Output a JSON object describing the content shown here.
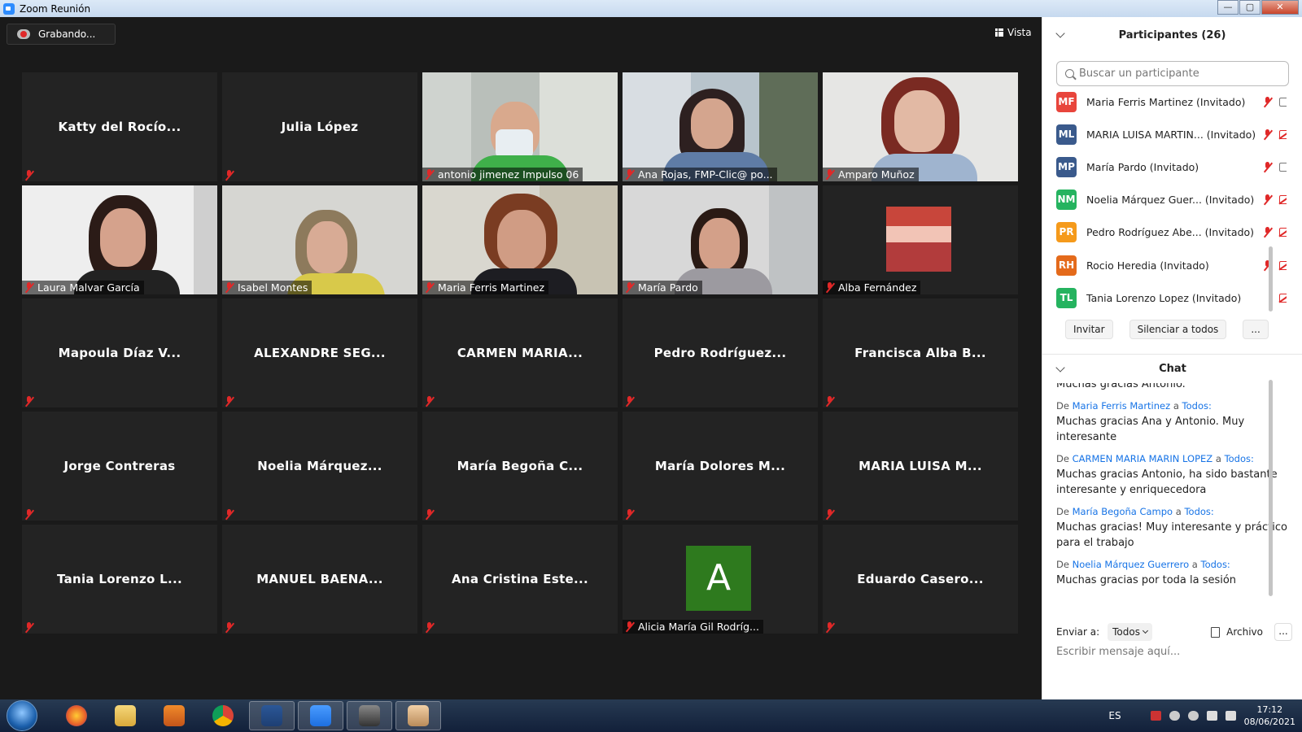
{
  "window": {
    "title": "Zoom Reunión",
    "minimize": "—",
    "maximize": "▢",
    "close": "✕"
  },
  "toolbar": {
    "recording_label": "Grabando...",
    "view_label": "Vista"
  },
  "tiles": [
    {
      "name": "Katty del Rocío...",
      "type": "text"
    },
    {
      "name": "Julia López",
      "type": "text"
    },
    {
      "name": "antonio jimenez Impulso 06",
      "type": "video"
    },
    {
      "name": "Ana Rojas, FMP-Clic@ po...",
      "type": "video",
      "active": true
    },
    {
      "name": "Amparo Muñoz",
      "type": "video"
    },
    {
      "name": "Laura Malvar García",
      "type": "video"
    },
    {
      "name": "Isabel Montes",
      "type": "video"
    },
    {
      "name": "Maria Ferris Martinez",
      "type": "video"
    },
    {
      "name": "María Pardo",
      "type": "video"
    },
    {
      "name": "Alba Fernández",
      "type": "photo"
    },
    {
      "name": "Mapoula Díaz V...",
      "type": "text"
    },
    {
      "name": "ALEXANDRE SEG...",
      "type": "text"
    },
    {
      "name": "CARMEN MARIA...",
      "type": "text"
    },
    {
      "name": "Pedro Rodríguez...",
      "type": "text"
    },
    {
      "name": "Francisca Alba B...",
      "type": "text"
    },
    {
      "name": "Jorge Contreras",
      "type": "text"
    },
    {
      "name": "Noelia Márquez...",
      "type": "text"
    },
    {
      "name": "María Begoña C...",
      "type": "text"
    },
    {
      "name": "María Dolores M...",
      "type": "text"
    },
    {
      "name": "MARIA LUISA M...",
      "type": "text"
    },
    {
      "name": "Tania Lorenzo L...",
      "type": "text"
    },
    {
      "name": "MANUEL BAENA...",
      "type": "text"
    },
    {
      "name": "Ana Cristina Este...",
      "type": "text"
    },
    {
      "name": "Alicia María Gil Rodríg...",
      "type": "avatar",
      "initial": "A"
    },
    {
      "name": "Eduardo Casero...",
      "type": "text"
    }
  ],
  "participants": {
    "header": "Participantes (26)",
    "search_placeholder": "Buscar un participante",
    "list": [
      {
        "initials": "MF",
        "name": "Maria Ferris Martinez (Invitado)",
        "color": "#e8453c",
        "video": true
      },
      {
        "initials": "ML",
        "name": "MARIA LUISA MARTIN... (Invitado)",
        "color": "#3a5a8c",
        "video": false
      },
      {
        "initials": "MP",
        "name": "María Pardo (Invitado)",
        "color": "#3a5a8c",
        "video": true
      },
      {
        "initials": "NM",
        "name": "Noelia Márquez Guer... (Invitado)",
        "color": "#25b35f",
        "video": false
      },
      {
        "initials": "PR",
        "name": "Pedro Rodríguez Abe... (Invitado)",
        "color": "#f59a1b",
        "video": false
      },
      {
        "initials": "RH",
        "name": "Rocio Heredia (Invitado)",
        "color": "#e46a1b",
        "video": false
      },
      {
        "initials": "TL",
        "name": "Tania Lorenzo Lopez (Invitado)",
        "color": "#25b35f",
        "video": false
      }
    ],
    "invite_label": "Invitar",
    "mute_all_label": "Silenciar a todos",
    "more_label": "..."
  },
  "chat": {
    "header": "Chat",
    "partial_top": "Muchas gracias Antonio.",
    "from_word": "De",
    "to_word": "a",
    "messages": [
      {
        "from": "Maria Ferris Martinez",
        "to": "Todos:",
        "text": "Muchas gracias Ana y Antonio. Muy interesante"
      },
      {
        "from": "CARMEN MARIA MARIN LOPEZ",
        "to": "Todos:",
        "text": "Muchas gracias Antonio, ha sido bastante interesante y enriquecedora"
      },
      {
        "from": "María Begoña Campo",
        "to": "Todos:",
        "text": "Muchas gracias! Muy interesante y práctico para el trabajo"
      },
      {
        "from": "Noelia Márquez Guerrero",
        "to": "Todos:",
        "text": "Muchas gracias por toda la sesión"
      }
    ],
    "send_to_label": "Enviar a:",
    "send_to_value": "Todos",
    "file_label": "Archivo",
    "more_label": "...",
    "input_placeholder": "Escribir mensaje aquí..."
  },
  "taskbar": {
    "apps": [
      "firefox-icon",
      "explorer-icon",
      "media-player-icon",
      "chrome-icon",
      "word-icon",
      "zoom-icon",
      "speaker-app-icon",
      "paint-icon"
    ],
    "language": "ES",
    "time": "17:12",
    "date": "08/06/2021"
  }
}
